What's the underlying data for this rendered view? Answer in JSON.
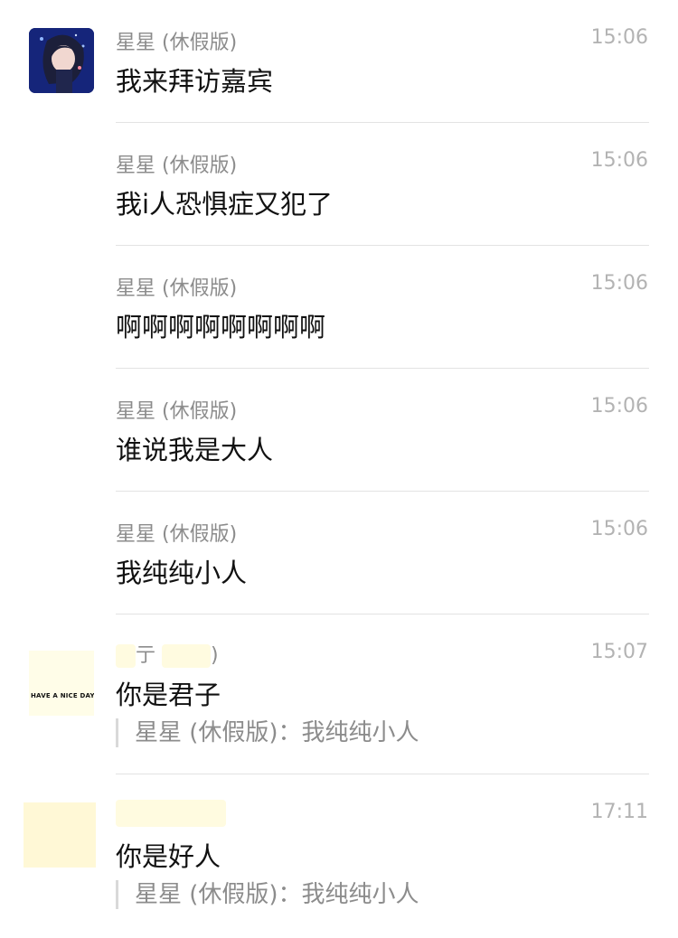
{
  "messages": [
    {
      "sender": "星星 (休假版)",
      "time": "15:06",
      "text": "我来拜访嘉宾"
    },
    {
      "sender": "星星 (休假版)",
      "time": "15:06",
      "text": "我i人恐惧症又犯了"
    },
    {
      "sender": "星星 (休假版)",
      "time": "15:06",
      "text": "啊啊啊啊啊啊啊啊"
    },
    {
      "sender": "星星 (休假版)",
      "time": "15:06",
      "text": "谁说我是大人"
    },
    {
      "sender": "星星 (休假版)",
      "time": "15:06",
      "text": "我纯纯小人"
    },
    {
      "sender_visible_a": "亍",
      "sender_visible_b": ")",
      "time": "15:07",
      "text": "你是君子",
      "quote": "星星 (休假版)：我纯纯小人",
      "avatar_caption": "HAVE A NICE DAY"
    },
    {
      "time": "17:11",
      "text": "你是好人",
      "quote": "星星 (休假版)：我纯纯小人"
    }
  ],
  "icons": {
    "avatar1": "anime-girl-avatar-icon"
  },
  "colors": {
    "sender": "#8c8c8c",
    "time": "#b3b3b3",
    "text": "#111111",
    "divider": "#e3e3e3"
  }
}
